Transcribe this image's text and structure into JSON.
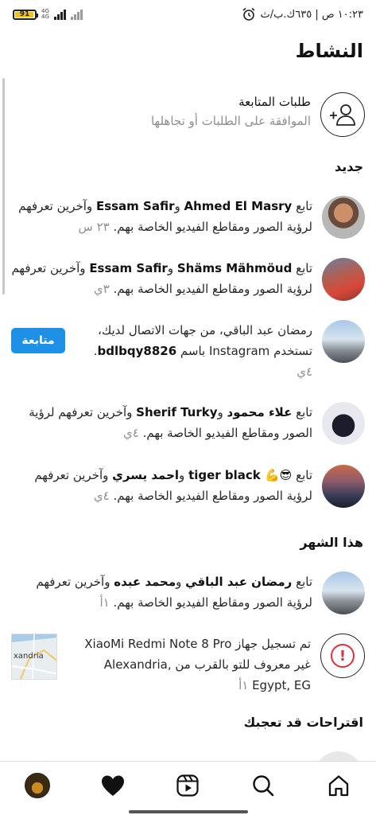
{
  "status_bar": {
    "time": "١٠:٢٣ ص | ٦٣٥ك.ب/ث",
    "battery": "91",
    "network_top": "4G",
    "network_bottom": "4G",
    "alarm_icon": "alarm-clock-icon"
  },
  "header": {
    "title": "النشاط"
  },
  "follow_requests": {
    "title": "طلبات المتابعة",
    "subtitle": "الموافقة على الطلبات أو تجاهلها",
    "icon": "add-person-icon"
  },
  "sections": {
    "new": "جديد",
    "this_month": "هذا الشهر",
    "suggestions": "اقتراحات قد تعجبك"
  },
  "new_items": [
    {
      "prefix": "تابع ",
      "name1": "Ahmed El Masry",
      "conj": " و",
      "name2": "Essam Safir",
      "suffix": " وآخرين تعرفهم لرؤية الصور ومقاطع الفيديو الخاصة بهم.",
      "time": " ٢٣ س"
    },
    {
      "prefix": "تابع ",
      "name1": "Shäms Mähmöud",
      "conj": " و",
      "name2": "Essam Safir",
      "suffix": " وآخرين تعرفهم لرؤية الصور ومقاطع الفيديو الخاصة بهم.",
      "time": " ٣ي"
    },
    {
      "text": "رمضان عبد الباقي، من جهات الاتصال لديك، تستخدم Instagram باسم ",
      "username": "bdlbqy8826",
      "suffix": ".",
      "time": "٤ي",
      "button": "متابعة"
    },
    {
      "prefix": "تابع ",
      "name1": "علاء محمود",
      "conj": " و",
      "name2": "Sherif Turky",
      "suffix": " وآخرين تعرفهم لرؤية الصور ومقاطع الفيديو الخاصة بهم.",
      "time": " ٤ي"
    },
    {
      "prefix": "تابع ",
      "name1": "😎💪 tiger black",
      "conj": " و",
      "name2": "احمد يسري",
      "suffix": " وآخرين تعرفهم لرؤية الصور ومقاطع الفيديو الخاصة بهم.",
      "time": " ٤ي"
    }
  ],
  "month_items": [
    {
      "prefix": "تابع ",
      "name1": "رمضان عبد الباقي",
      "conj": " و",
      "name2": "محمد عبده",
      "suffix": " وآخرين تعرفهم لرؤية الصور ومقاطع الفيديو الخاصة بهم.",
      "time": " ١أ"
    },
    {
      "text": "تم تسجيل جهاز XiaoMi Redmi Note 8 Pro غير معروف للتو بالقرب من Alexandria, Egypt, EG",
      "time": " ١أ",
      "map_label": "xandria"
    }
  ],
  "bottom_nav": [
    "home-icon",
    "search-icon",
    "reels-icon",
    "heart-icon",
    "profile-avatar"
  ]
}
